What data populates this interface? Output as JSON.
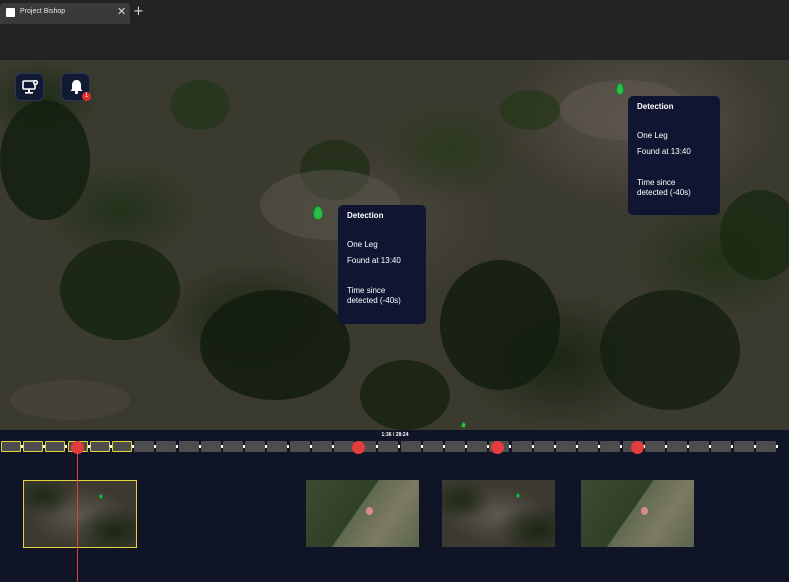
{
  "browser": {
    "tab_title": "Project Bishop",
    "close_label": "✕",
    "new_tab_label": "+"
  },
  "map": {
    "controls": [
      {
        "name": "display-settings",
        "icon": "monitor-settings-icon"
      },
      {
        "name": "alerts",
        "icon": "bell-icon",
        "badge": "1"
      }
    ],
    "detections": [
      {
        "title": "Detection",
        "object": "One Leg",
        "found": "Found at 13:40",
        "since_line1": "Time since",
        "since_line2": "detected (-40s)"
      },
      {
        "title": "Detection",
        "object": "One Leg",
        "found": "Found at 13:40",
        "since_line1": "Time since",
        "since_line2": "detected (-40s)"
      }
    ]
  },
  "timeline": {
    "time_label": "1:36 / 28:24",
    "accent_color": "#e23c3c",
    "active_color": "#e3d43d",
    "thumbnails": [
      {
        "name": "thumbnail-1",
        "selected": true
      },
      {
        "name": "thumbnail-2",
        "selected": false
      },
      {
        "name": "thumbnail-3",
        "selected": false
      },
      {
        "name": "thumbnail-4",
        "selected": false
      }
    ]
  }
}
